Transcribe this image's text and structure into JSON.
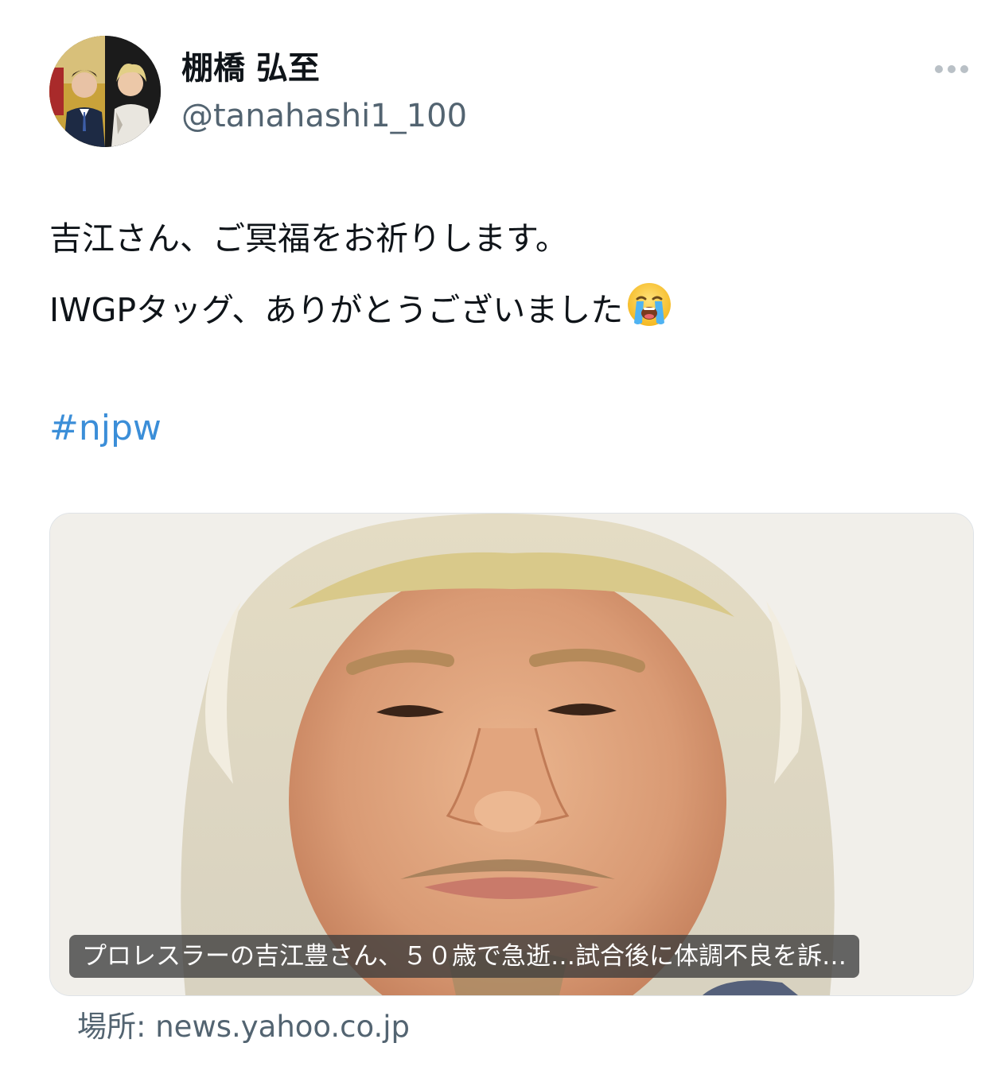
{
  "author": {
    "display_name": "棚橋 弘至",
    "handle": "@tanahashi1_100"
  },
  "tweet": {
    "line1": "吉江さん、ご冥福をお祈りします。",
    "line2": "IWGPタッグ、ありがとうございました",
    "emoji": "loudly-crying-face",
    "hashtag": "#njpw"
  },
  "link_card": {
    "caption": "プロレスラーの吉江豊さん、５０歳で急逝…試合後に体調不良を訴…",
    "source_prefix": "場所: ",
    "source_domain": "news.yahoo.co.jp"
  },
  "colors": {
    "hashtag": "#3b8ed8",
    "secondary_text": "#536471"
  }
}
